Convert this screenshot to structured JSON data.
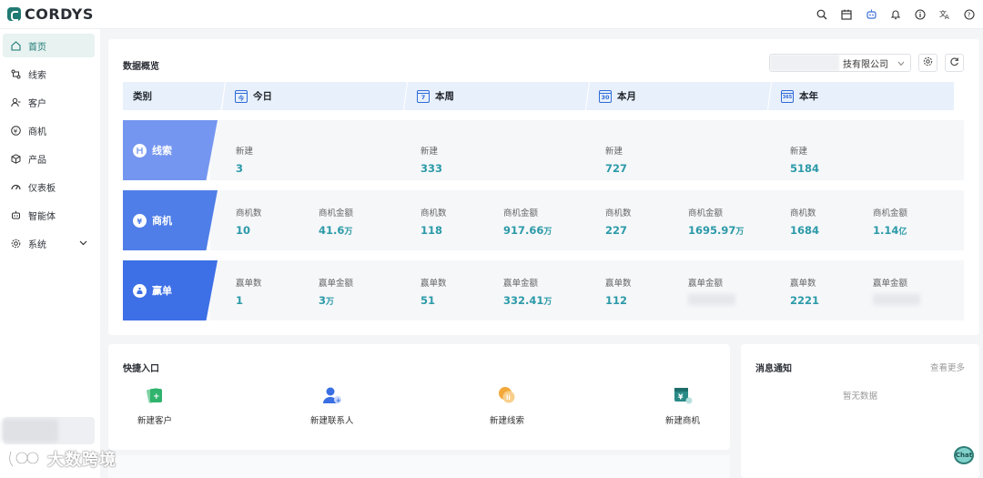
{
  "app": {
    "logo_text": "CORDYS"
  },
  "topbar": {
    "icons": [
      "search-icon",
      "calendar-icon",
      "robot-icon",
      "bell-icon",
      "info-icon",
      "translate-icon",
      "help-icon"
    ]
  },
  "sidebar": {
    "items": [
      {
        "label": "首页",
        "icon": "home-icon"
      },
      {
        "label": "线索",
        "icon": "lead-icon"
      },
      {
        "label": "客户",
        "icon": "customer-icon"
      },
      {
        "label": "商机",
        "icon": "yen-circle-icon"
      },
      {
        "label": "产品",
        "icon": "box-icon"
      },
      {
        "label": "仪表板",
        "icon": "dashboard-icon"
      },
      {
        "label": "智能体",
        "icon": "agent-icon"
      },
      {
        "label": "系统",
        "icon": "settings-icon"
      }
    ]
  },
  "overview": {
    "title": "数据概览",
    "company_label": "技有限公司",
    "header": {
      "category": "类别",
      "periods": [
        {
          "label": "今日",
          "badge": "今"
        },
        {
          "label": "本周",
          "badge": "7"
        },
        {
          "label": "本月",
          "badge": "30"
        },
        {
          "label": "本年",
          "badge": "365"
        }
      ]
    },
    "rows": [
      {
        "label": "线索",
        "icon": "lead-badge-icon",
        "color": "#7596f0",
        "cells": [
          [
            {
              "label": "新建",
              "value": "3",
              "unit": ""
            }
          ],
          [
            {
              "label": "新建",
              "value": "333",
              "unit": ""
            }
          ],
          [
            {
              "label": "新建",
              "value": "727",
              "unit": ""
            }
          ],
          [
            {
              "label": "新建",
              "value": "5184",
              "unit": ""
            }
          ]
        ]
      },
      {
        "label": "商机",
        "icon": "yen-badge-icon",
        "color": "#4f7ee8",
        "cells": [
          [
            {
              "label": "商机数",
              "value": "10",
              "unit": ""
            },
            {
              "label": "商机金额",
              "value": "41.6",
              "unit": "万"
            }
          ],
          [
            {
              "label": "商机数",
              "value": "118",
              "unit": ""
            },
            {
              "label": "商机金额",
              "value": "917.66",
              "unit": "万"
            }
          ],
          [
            {
              "label": "商机数",
              "value": "227",
              "unit": ""
            },
            {
              "label": "商机金额",
              "value": "1695.97",
              "unit": "万"
            }
          ],
          [
            {
              "label": "商机数",
              "value": "1684",
              "unit": ""
            },
            {
              "label": "商机金额",
              "value": "1.14",
              "unit": "亿"
            }
          ]
        ]
      },
      {
        "label": "赢单",
        "icon": "money-bag-icon",
        "color": "#3d6fe6",
        "cells": [
          [
            {
              "label": "赢单数",
              "value": "1",
              "unit": ""
            },
            {
              "label": "赢单金额",
              "value": "3",
              "unit": "万"
            }
          ],
          [
            {
              "label": "赢单数",
              "value": "51",
              "unit": ""
            },
            {
              "label": "赢单金额",
              "value": "332.41",
              "unit": "万"
            }
          ],
          [
            {
              "label": "赢单数",
              "value": "112",
              "unit": ""
            },
            {
              "label": "赢单金额",
              "value": "",
              "unit": ""
            }
          ],
          [
            {
              "label": "赢单数",
              "value": "2221",
              "unit": ""
            },
            {
              "label": "赢单金额",
              "value": "",
              "unit": ""
            }
          ]
        ]
      }
    ]
  },
  "quick": {
    "title": "快捷入口",
    "items": [
      {
        "label": "新建客户",
        "icon": "new-customer-icon"
      },
      {
        "label": "新建联系人",
        "icon": "new-contact-icon"
      },
      {
        "label": "新建线索",
        "icon": "new-lead-icon"
      },
      {
        "label": "新建商机",
        "icon": "new-opportunity-icon"
      }
    ]
  },
  "messages": {
    "title": "消息通知",
    "more": "查看更多",
    "empty": "暂无数据"
  },
  "watermark": {
    "text": "大数跨境"
  },
  "chat": {
    "badge": "Chat"
  }
}
